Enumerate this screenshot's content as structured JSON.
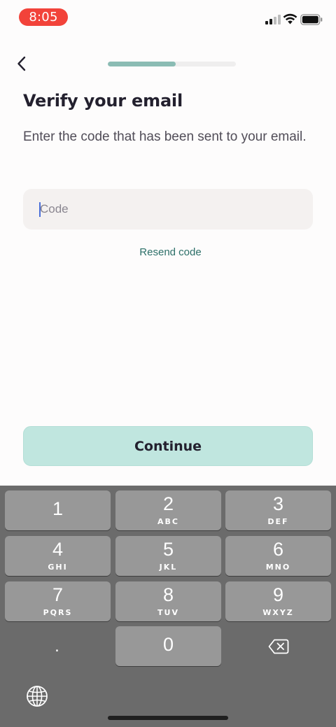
{
  "status_bar": {
    "time": "8:05",
    "time_pill_color": "#f2433a"
  },
  "header": {
    "back_icon": "chevron-left-icon",
    "progress_fraction": 0.53,
    "progress_color": "#8bbcb4"
  },
  "main": {
    "title": "Verify your email",
    "subtitle": "Enter the code that has been sent to your email.",
    "code_field": {
      "value": "",
      "placeholder": "Code"
    },
    "resend_label": "Resend code",
    "continue_label": "Continue",
    "accent_color": "#c0e6df"
  },
  "keyboard": {
    "keys": [
      {
        "digit": "1",
        "letters": ""
      },
      {
        "digit": "2",
        "letters": "ABC"
      },
      {
        "digit": "3",
        "letters": "DEF"
      },
      {
        "digit": "4",
        "letters": "GHI"
      },
      {
        "digit": "5",
        "letters": "JKL"
      },
      {
        "digit": "6",
        "letters": "MNO"
      },
      {
        "digit": "7",
        "letters": "PQRS"
      },
      {
        "digit": "8",
        "letters": "TUV"
      },
      {
        "digit": "9",
        "letters": "WXYZ"
      },
      {
        "digit": "0",
        "letters": ""
      }
    ],
    "dot_label": ".",
    "delete_icon": "backspace-icon",
    "globe_icon": "globe-icon"
  }
}
